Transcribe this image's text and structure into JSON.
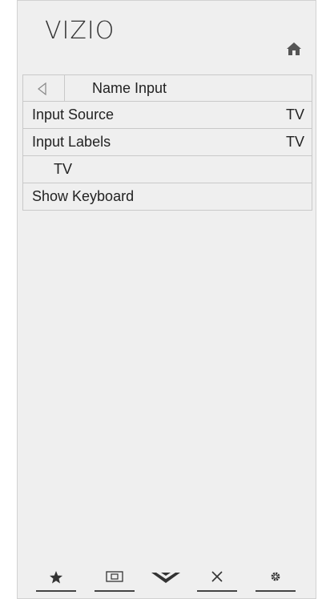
{
  "header": {
    "logo": "VIZIO",
    "home_icon": "home-icon"
  },
  "menu": {
    "title": "Name Input",
    "back_icon": "back-arrow-icon",
    "items": [
      {
        "label": "Input Source",
        "value": "TV"
      },
      {
        "label": "Input Labels",
        "value": "TV"
      },
      {
        "label": "TV",
        "value": ""
      },
      {
        "label": "Show Keyboard",
        "value": ""
      }
    ]
  },
  "bottom_bar": {
    "icons": [
      "star-icon",
      "widescreen-icon",
      "vizio-v-icon",
      "close-icon",
      "gear-icon"
    ]
  },
  "colors": {
    "panel_bg": "#efefef",
    "border": "#c9c9c9",
    "text": "#222222"
  }
}
